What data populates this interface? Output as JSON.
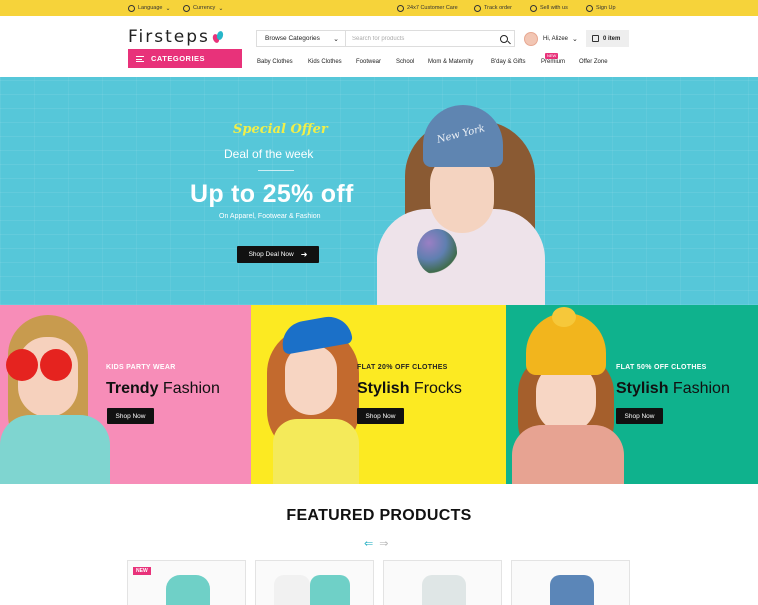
{
  "topbar": {
    "language": "Language",
    "currency": "Currency",
    "customer_care": "24x7 Customer Care",
    "track_order": "Track order",
    "sell": "Sell with us",
    "signup": "Sign Up"
  },
  "header": {
    "logo": "Firsteps",
    "categories_label": "CATEGORIES",
    "browse_label": "Browse Categories",
    "search_placeholder": "Search for products",
    "user_greeting": "Hi, Alizee",
    "cart_label": "0 item"
  },
  "nav": {
    "items": [
      "Baby Clothes",
      "Kids Clothes",
      "Footwear",
      "School",
      "Mom & Maternity",
      "B'day & Gifts",
      "Premium",
      "Offer Zone"
    ],
    "premium_badge": "NEW"
  },
  "hero": {
    "special": "Special Offer",
    "deal": "Deal of the week",
    "headline": "Up to 25% off",
    "subline": "On Apparel, Footwear & Fashion",
    "cta": "Shop Deal Now",
    "hat_text": "New York",
    "bg_color": "#56c7d9"
  },
  "promos": [
    {
      "kicker": "KIDS PARTY WEAR",
      "title_bold": "Trendy",
      "title_rest": " Fashion",
      "cta": "Shop Now",
      "bg": "#f78db8"
    },
    {
      "kicker": "FLAT 20% OFF CLOTHES",
      "title_bold": "Stylish",
      "title_rest": " Frocks",
      "cta": "Shop Now",
      "bg": "#fcea22"
    },
    {
      "kicker": "FLAT 50% OFF CLOTHES",
      "title_bold": "Stylish",
      "title_rest": " Fashion",
      "cta": "Shop Now",
      "bg": "#0fb28d"
    }
  ],
  "featured": {
    "title": "FEATURED PRODUCTS",
    "prev_icon": "arrow-left-icon",
    "next_icon": "arrow-right-icon",
    "products": [
      {
        "badge": "NEW",
        "color": "#6fd0c7"
      },
      {
        "badge": "",
        "color": "#6fd0c7"
      },
      {
        "badge": "",
        "color": "#dfe6e6"
      },
      {
        "badge": "",
        "color": "#5b86b8"
      }
    ]
  },
  "colors": {
    "topbar": "#f6d33a",
    "accent": "#e8327a"
  }
}
